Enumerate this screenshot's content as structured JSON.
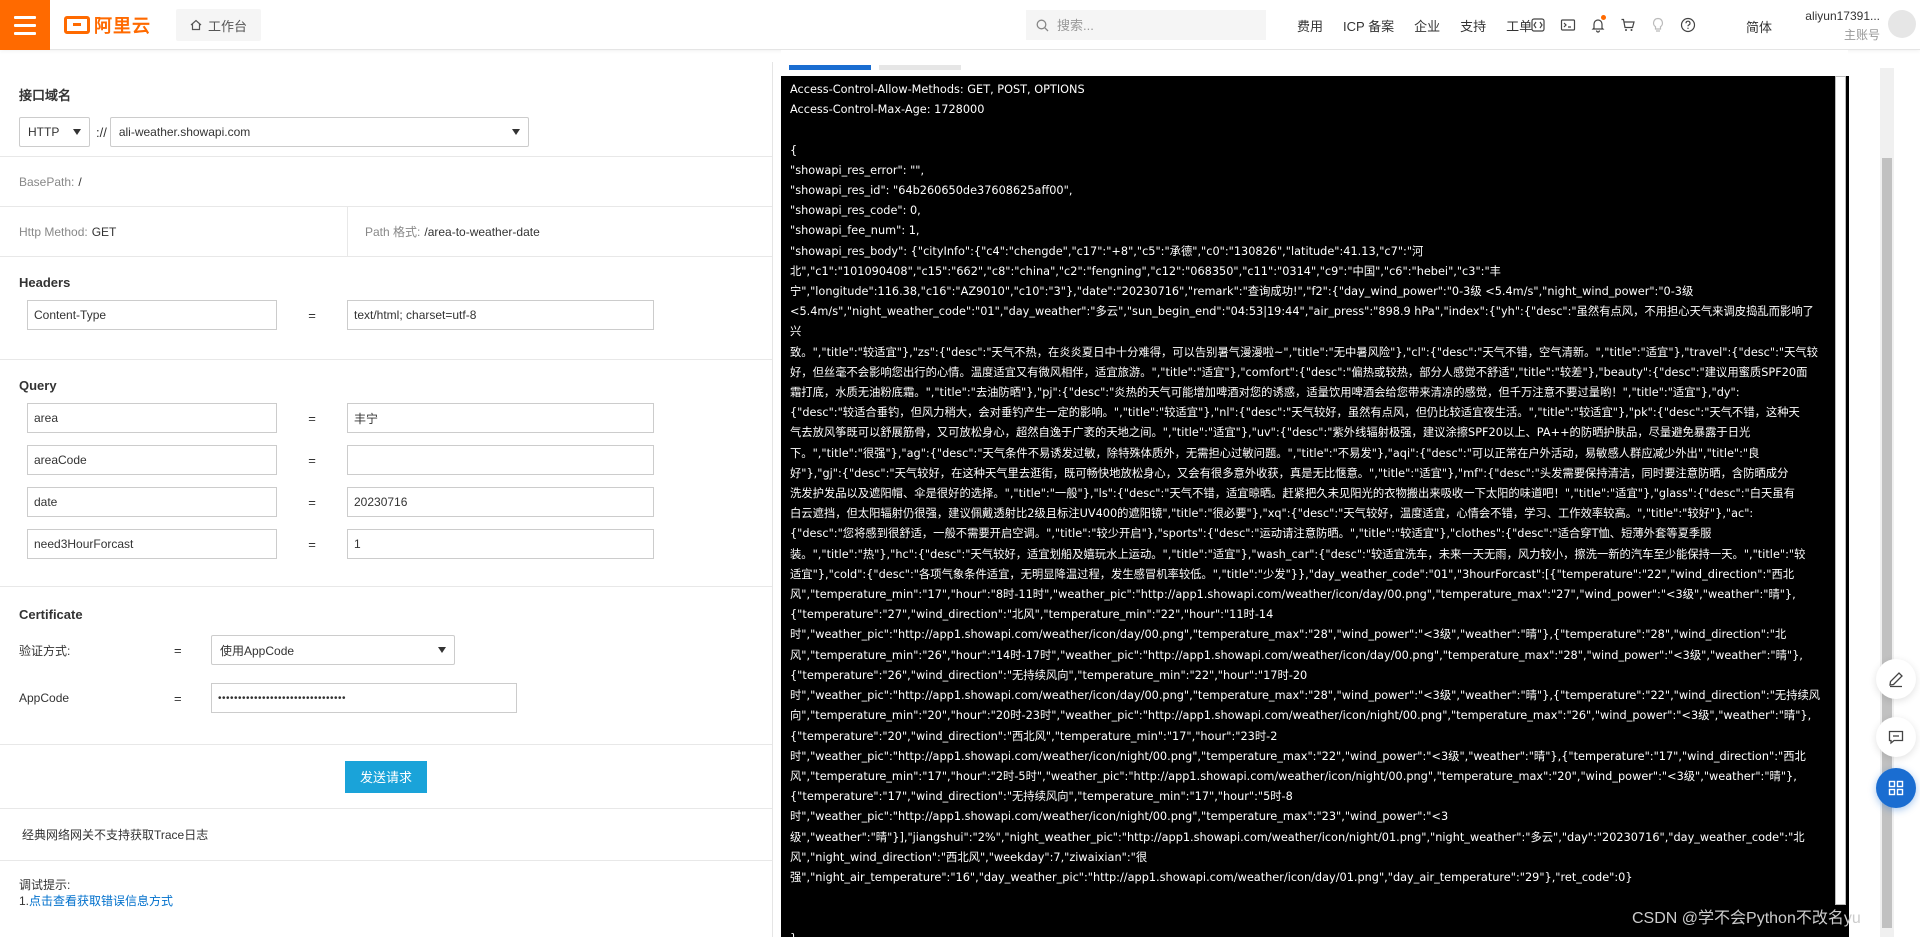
{
  "topbar": {
    "logo_text": "阿里云",
    "workbench_label": "工作台",
    "search_placeholder": "搜索...",
    "nav_links": [
      "费用",
      "ICP 备案",
      "企业",
      "支持",
      "工单"
    ],
    "language": "简体",
    "account_name": "aliyun17391...",
    "account_role": "主账号"
  },
  "left": {
    "domain_section": {
      "title": "接口域名",
      "protocol": "HTTP",
      "separator": "://",
      "domain": "ali-weather.showapi.com"
    },
    "basepath": {
      "label": "BasePath:",
      "value": "/"
    },
    "method": {
      "label": "Http Method:",
      "value": "GET"
    },
    "path": {
      "label": "Path 格式:",
      "value": "/area-to-weather-date"
    },
    "headers": {
      "title": "Headers",
      "rows": [
        {
          "key": "Content-Type",
          "eq": "=",
          "value": "text/html; charset=utf-8"
        }
      ]
    },
    "query": {
      "title": "Query",
      "rows": [
        {
          "key": "area",
          "eq": "=",
          "value": "丰宁"
        },
        {
          "key": "areaCode",
          "eq": "=",
          "value": ""
        },
        {
          "key": "date",
          "eq": "=",
          "value": "20230716"
        },
        {
          "key": "need3HourForcast",
          "eq": "=",
          "value": "1"
        }
      ]
    },
    "certificate": {
      "title": "Certificate",
      "auth_label": "验证方式:",
      "auth_eq": "=",
      "auth_value": "使用AppCode",
      "appcode_label": "AppCode",
      "appcode_eq": "=",
      "appcode_value": "••••••••••••••••••••••••••••••••"
    },
    "send_button": "发送请求",
    "trace_note": "经典网络网关不支持获取Trace日志",
    "debug_hint_title": "调试提示:",
    "debug_hint_prefix": "1.",
    "debug_hint_link": "点击查看获取错误信息方式"
  },
  "console": {
    "text": "Access-Control-Allow-Methods: GET, POST, OPTIONS\nAccess-Control-Max-Age: 1728000\n\n{\n\"showapi_res_error\": \"\",\n\"showapi_res_id\": \"64b260650de37608625aff00\",\n\"showapi_res_code\": 0,\n\"showapi_fee_num\": 1,\n\"showapi_res_body\": {\"cityInfo\":{\"c4\":\"chengde\",\"c17\":\"+8\",\"c5\":\"承德\",\"c0\":\"130826\",\"latitude\":41.13,\"c7\":\"河\n北\",\"c1\":\"101090408\",\"c15\":\"662\",\"c8\":\"china\",\"c2\":\"fengning\",\"c12\":\"068350\",\"c11\":\"0314\",\"c9\":\"中国\",\"c6\":\"hebei\",\"c3\":\"丰\n宁\",\"longitude\":116.38,\"c16\":\"AZ9010\",\"c10\":\"3\"},\"date\":\"20230716\",\"remark\":\"查询成功!\",\"f2\":{\"day_wind_power\":\"0-3级 <5.4m/s\",\"night_wind_power\":\"0-3级\n<5.4m/s\",\"night_weather_code\":\"01\",\"day_weather\":\"多云\",\"sun_begin_end\":\"04:53|19:44\",\"air_press\":\"898.9 hPa\",\"index\":{\"yh\":{\"desc\":\"虽然有点风，不用担心天气来调皮捣乱而影响了兴\n致。\",\"title\":\"较适宜\"},\"zs\":{\"desc\":\"天气不热，在炎炎夏日中十分难得，可以告别暑气漫漫啦~\",\"title\":\"无中暑风险\"},\"cl\":{\"desc\":\"天气不错，空气清新。\",\"title\":\"适宜\"},\"travel\":{\"desc\":\"天气较\n好，但丝毫不会影响您出行的心情。温度适宜又有微风相伴，适宜旅游。\",\"title\":\"适宜\"},\"comfort\":{\"desc\":\"偏热或较热，部分人感觉不舒适\",\"title\":\"较差\"},\"beauty\":{\"desc\":\"建议用蜜质SPF20面\n霜打底，水质无油粉底霜。\",\"title\":\"去油防晒\"},\"pj\":{\"desc\":\"炎热的天气可能增加啤酒对您的诱惑，适量饮用啤酒会给您带来清凉的感觉，但千万注意不要过量哟！\",\"title\":\"适宜\"},\"dy\":\n{\"desc\":\"较适合垂钓，但风力稍大，会对垂钓产生一定的影响。\",\"title\":\"较适宜\"},\"nl\":{\"desc\":\"天气较好，虽然有点风，但仍比较适宜夜生活。\",\"title\":\"较适宜\"},\"pk\":{\"desc\":\"天气不错，这种天\n气去放风筝既可以舒展筋骨，又可放松身心，超然自逸于广袤的天地之间。\",\"title\":\"适宜\"},\"uv\":{\"desc\":\"紫外线辐射极强，建议涂擦SPF20以上、PA++的防晒护肤品，尽量避免暴露于日光\n下。\",\"title\":\"很强\"},\"ag\":{\"desc\":\"天气条件不易诱发过敏，除特殊体质外，无需担心过敏问题。\",\"title\":\"不易发\"},\"aqi\":{\"desc\":\"可以正常在户外活动，易敏感人群应减少外出\",\"title\":\"良\n好\"},\"gj\":{\"desc\":\"天气较好，在这种天气里去逛街，既可畅快地放松身心，又会有很多意外收获，真是无比惬意。\",\"title\":\"适宜\"},\"mf\":{\"desc\":\"头发需要保持清洁，同时要注意防晒，含防晒成分\n洗发护发品以及遮阳帽、伞是很好的选择。\",\"title\":\"一般\"},\"ls\":{\"desc\":\"天气不错，适宜晾晒。赶紧把久未见阳光的衣物搬出来吸收一下太阳的味道吧！\",\"title\":\"适宜\"},\"glass\":{\"desc\":\"白天虽有\n白云遮挡，但太阳辐射仍很强，建议佩戴透射比2级且标注UV400的遮阳镜\",\"title\":\"很必要\"},\"xq\":{\"desc\":\"天气较好，温度适宜，心情会不错，学习、工作效率较高。\",\"title\":\"较好\"},\"ac\":\n{\"desc\":\"您将感到很舒适，一般不需要开启空调。\",\"title\":\"较少开启\"},\"sports\":{\"desc\":\"运动请注意防晒。\",\"title\":\"较适宜\"},\"clothes\":{\"desc\":\"适合穿T恤、短薄外套等夏季服\n装。\",\"title\":\"热\"},\"hc\":{\"desc\":\"天气较好，适宜划船及嬉玩水上运动。\",\"title\":\"适宜\"},\"wash_car\":{\"desc\":\"较适宜洗车，未来一天无雨，风力较小，擦洗一新的汽车至少能保持一天。\",\"title\":\"较\n适宜\"},\"cold\":{\"desc\":\"各项气象条件适宜，无明显降温过程，发生感冒机率较低。\",\"title\":\"少发\"}},\"day_weather_code\":\"01\",\"3hourForcast\":[{\"temperature\":\"22\",\"wind_direction\":\"西北\n风\",\"temperature_min\":\"17\",\"hour\":\"8时-11时\",\"weather_pic\":\"http://app1.showapi.com/weather/icon/day/00.png\",\"temperature_max\":\"27\",\"wind_power\":\"<3级\",\"weather\":\"晴\"},\n{\"temperature\":\"27\",\"wind_direction\":\"北风\",\"temperature_min\":\"22\",\"hour\":\"11时-14\n时\",\"weather_pic\":\"http://app1.showapi.com/weather/icon/day/00.png\",\"temperature_max\":\"28\",\"wind_power\":\"<3级\",\"weather\":\"晴\"},{\"temperature\":\"28\",\"wind_direction\":\"北\n风\",\"temperature_min\":\"26\",\"hour\":\"14时-17时\",\"weather_pic\":\"http://app1.showapi.com/weather/icon/day/00.png\",\"temperature_max\":\"28\",\"wind_power\":\"<3级\",\"weather\":\"晴\"},\n{\"temperature\":\"26\",\"wind_direction\":\"无持续风向\",\"temperature_min\":\"22\",\"hour\":\"17时-20\n时\",\"weather_pic\":\"http://app1.showapi.com/weather/icon/day/00.png\",\"temperature_max\":\"28\",\"wind_power\":\"<3级\",\"weather\":\"晴\"},{\"temperature\":\"22\",\"wind_direction\":\"无持续风\n向\",\"temperature_min\":\"20\",\"hour\":\"20时-23时\",\"weather_pic\":\"http://app1.showapi.com/weather/icon/night/00.png\",\"temperature_max\":\"26\",\"wind_power\":\"<3级\",\"weather\":\"晴\"},\n{\"temperature\":\"20\",\"wind_direction\":\"西北风\",\"temperature_min\":\"17\",\"hour\":\"23时-2\n时\",\"weather_pic\":\"http://app1.showapi.com/weather/icon/night/00.png\",\"temperature_max\":\"22\",\"wind_power\":\"<3级\",\"weather\":\"晴\"},{\"temperature\":\"17\",\"wind_direction\":\"西北\n风\",\"temperature_min\":\"17\",\"hour\":\"2时-5时\",\"weather_pic\":\"http://app1.showapi.com/weather/icon/night/00.png\",\"temperature_max\":\"20\",\"wind_power\":\"<3级\",\"weather\":\"晴\"},\n{\"temperature\":\"17\",\"wind_direction\":\"无持续风向\",\"temperature_min\":\"17\",\"hour\":\"5时-8\n时\",\"weather_pic\":\"http://app1.showapi.com/weather/icon/night/00.png\",\"temperature_max\":\"23\",\"wind_power\":\"<3\n级\",\"weather\":\"晴\"}],\"jiangshui\":\"2%\",\"night_weather_pic\":\"http://app1.showapi.com/weather/icon/night/01.png\",\"night_weather\":\"多云\",\"day\":\"20230716\",\"day_weather_code\":\"北\n风\",\"night_wind_direction\":\"西北风\",\"weekday\":7,\"ziwaixian\":\"很\n强\",\"night_air_temperature\":\"16\",\"day_weather_pic\":\"http://app1.showapi.com/weather/icon/day/01.png\",\"day_air_temperature\":\"29\"},\"ret_code\":0}\n\n\n}"
  },
  "watermark": "CSDN @学不会Python不改名yu",
  "colors": {
    "brand": "#ff6a00",
    "primary": "#1a6dd1",
    "send_button": "#1aa3d9",
    "link": "#0070cc"
  }
}
